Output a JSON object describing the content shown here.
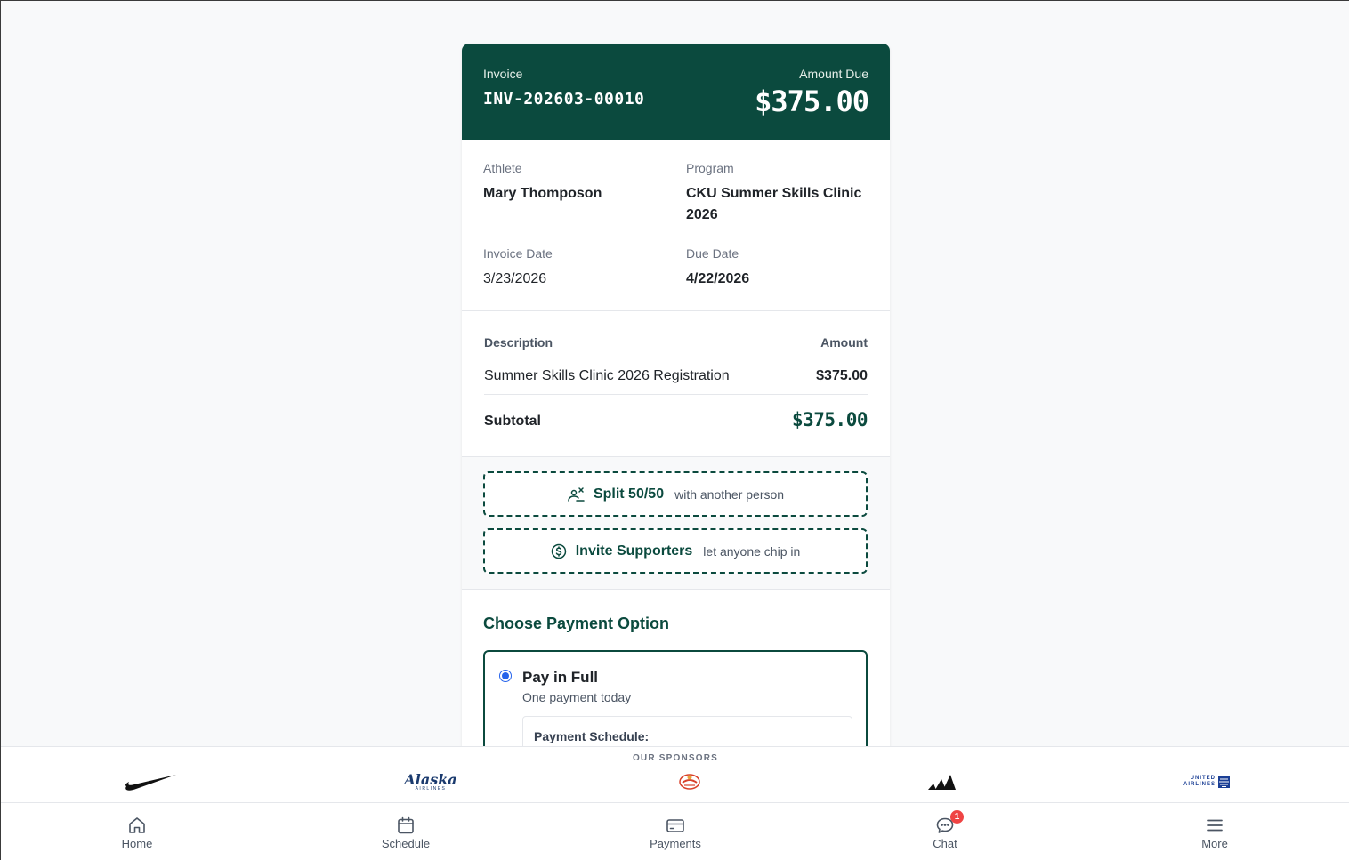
{
  "invoice": {
    "label": "Invoice",
    "number": "INV-202603-00010",
    "amount_due_label": "Amount Due",
    "amount_due": "$375.00"
  },
  "details": {
    "athlete_label": "Athlete",
    "athlete": "Mary Thomposon",
    "program_label": "Program",
    "program": "CKU Summer Skills Clinic 2026",
    "invoice_date_label": "Invoice Date",
    "invoice_date": "3/23/2026",
    "due_date_label": "Due Date",
    "due_date": "4/22/2026"
  },
  "line_items": {
    "headers": {
      "description": "Description",
      "amount": "Amount"
    },
    "rows": [
      {
        "description": "Summer Skills Clinic 2026 Registration",
        "amount": "$375.00"
      }
    ],
    "subtotal_label": "Subtotal",
    "subtotal": "$375.00"
  },
  "share": {
    "split": {
      "label": "Split 50/50",
      "sub": "with another person",
      "icon": "split-person-icon"
    },
    "invite": {
      "label": "Invite Supporters",
      "sub": "let anyone chip in",
      "icon": "dollar-circle-icon"
    }
  },
  "payment": {
    "heading": "Choose Payment Option",
    "option": {
      "title": "Pay in Full",
      "sub": "One payment today",
      "selected": true
    },
    "schedule_label": "Payment Schedule:"
  },
  "sponsors": {
    "title": "OUR SPONSORS",
    "logos": [
      "Nike",
      "Alaska Airlines",
      "Chorizo sponsor",
      "adidas",
      "United Airlines"
    ],
    "alaska_text": "Alaska",
    "alaska_sub": "AIRLINES",
    "united_text_1": "UNITED",
    "united_text_2": "AIRLINES"
  },
  "nav": {
    "items": [
      {
        "label": "Home",
        "icon": "home-icon"
      },
      {
        "label": "Schedule",
        "icon": "calendar-icon"
      },
      {
        "label": "Payments",
        "icon": "card-icon"
      },
      {
        "label": "Chat",
        "icon": "chat-icon",
        "badge": "1"
      },
      {
        "label": "More",
        "icon": "menu-icon"
      }
    ]
  },
  "colors": {
    "brand": "#0b4a3e",
    "badge": "#ef4444",
    "radio": "#2563eb"
  }
}
